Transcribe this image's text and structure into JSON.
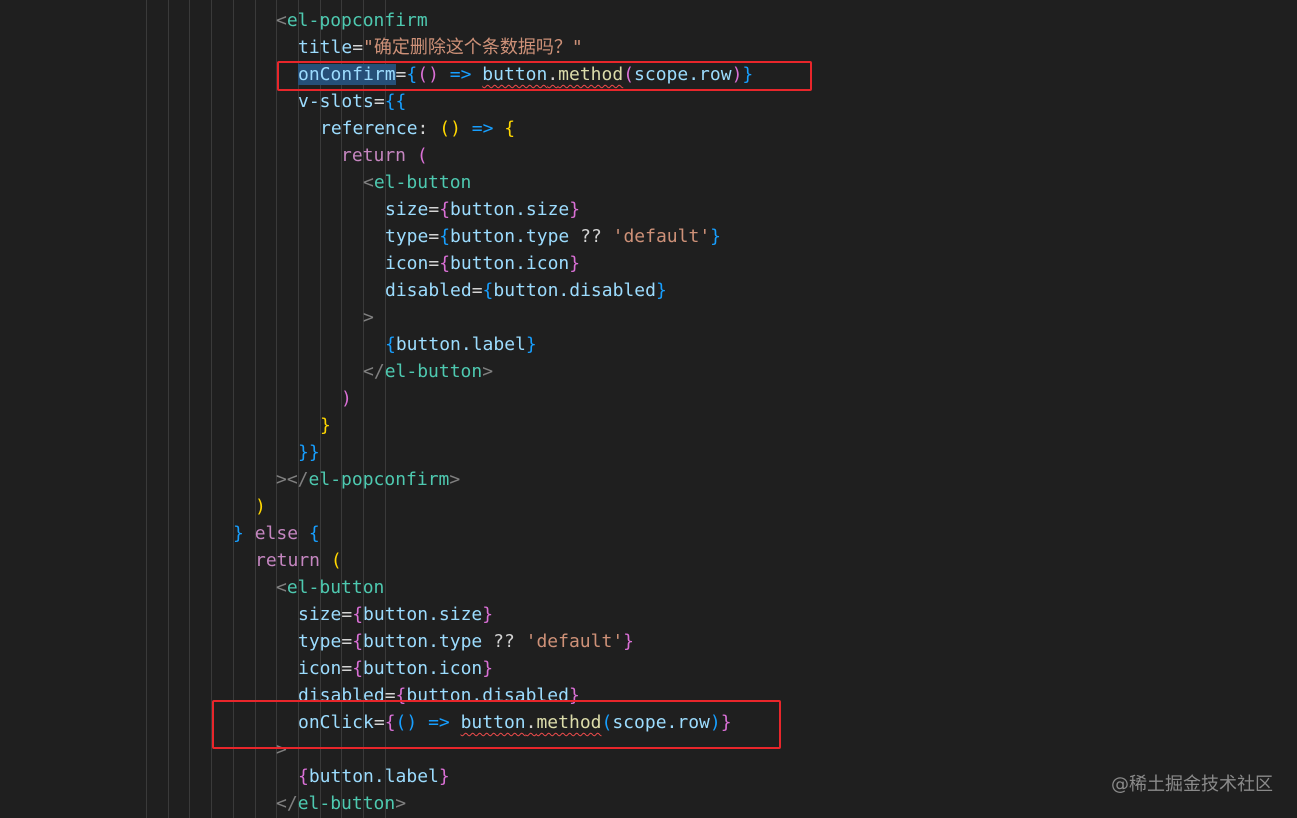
{
  "code_lines": [
    {
      "indent": 12,
      "tokens": [
        {
          "t": "<",
          "c": "punct"
        },
        {
          "t": "el-popconfirm",
          "c": "tag"
        }
      ]
    },
    {
      "indent": 14,
      "tokens": [
        {
          "t": "title",
          "c": "attr"
        },
        {
          "t": "=",
          "c": "plain"
        },
        {
          "t": "\"确定删除这个条数据吗？\"",
          "c": "string"
        }
      ]
    },
    {
      "indent": 14,
      "tokens": [
        {
          "t": "onConfirm",
          "c": "attr-hl"
        },
        {
          "t": "=",
          "c": "plain"
        },
        {
          "t": "{",
          "c": "brace3"
        },
        {
          "t": "()",
          "c": "brace2"
        },
        {
          "t": " => ",
          "c": "brace3"
        },
        {
          "t": "button",
          "c": "var",
          "sq": true
        },
        {
          "t": ".",
          "c": "plain",
          "sq": true
        },
        {
          "t": "method",
          "c": "func",
          "sq": true
        },
        {
          "t": "(",
          "c": "brace2"
        },
        {
          "t": "scope.row",
          "c": "var"
        },
        {
          "t": ")",
          "c": "brace2"
        },
        {
          "t": "}",
          "c": "brace3"
        }
      ]
    },
    {
      "indent": 14,
      "tokens": [
        {
          "t": "v-slots",
          "c": "attr"
        },
        {
          "t": "=",
          "c": "plain"
        },
        {
          "t": "{{",
          "c": "brace3"
        }
      ]
    },
    {
      "indent": 16,
      "tokens": [
        {
          "t": "reference",
          "c": "attr"
        },
        {
          "t": ": ",
          "c": "plain"
        },
        {
          "t": "()",
          "c": "brace1"
        },
        {
          "t": " => ",
          "c": "brace3"
        },
        {
          "t": "{",
          "c": "brace1"
        }
      ]
    },
    {
      "indent": 18,
      "tokens": [
        {
          "t": "return",
          "c": "keyword"
        },
        {
          "t": " ",
          "c": "plain"
        },
        {
          "t": "(",
          "c": "brace2"
        }
      ]
    },
    {
      "indent": 20,
      "tokens": [
        {
          "t": "<",
          "c": "punct"
        },
        {
          "t": "el-button",
          "c": "tag"
        }
      ]
    },
    {
      "indent": 22,
      "tokens": [
        {
          "t": "size",
          "c": "attr"
        },
        {
          "t": "=",
          "c": "plain"
        },
        {
          "t": "{",
          "c": "brace2"
        },
        {
          "t": "button.size",
          "c": "var"
        },
        {
          "t": "}",
          "c": "brace2"
        }
      ]
    },
    {
      "indent": 22,
      "tokens": [
        {
          "t": "type",
          "c": "attr"
        },
        {
          "t": "=",
          "c": "plain"
        },
        {
          "t": "{",
          "c": "brace3"
        },
        {
          "t": "button.type",
          "c": "var"
        },
        {
          "t": " ?? ",
          "c": "plain"
        },
        {
          "t": "'default'",
          "c": "string"
        },
        {
          "t": "}",
          "c": "brace3"
        }
      ]
    },
    {
      "indent": 22,
      "tokens": [
        {
          "t": "icon",
          "c": "attr"
        },
        {
          "t": "=",
          "c": "plain"
        },
        {
          "t": "{",
          "c": "brace2"
        },
        {
          "t": "button.icon",
          "c": "var"
        },
        {
          "t": "}",
          "c": "brace2"
        }
      ]
    },
    {
      "indent": 22,
      "tokens": [
        {
          "t": "disabled",
          "c": "attr"
        },
        {
          "t": "=",
          "c": "plain"
        },
        {
          "t": "{",
          "c": "brace3"
        },
        {
          "t": "button.disabled",
          "c": "var"
        },
        {
          "t": "}",
          "c": "brace3"
        }
      ]
    },
    {
      "indent": 20,
      "tokens": [
        {
          "t": ">",
          "c": "punct"
        }
      ]
    },
    {
      "indent": 22,
      "tokens": [
        {
          "t": "{",
          "c": "brace3"
        },
        {
          "t": "button.label",
          "c": "var"
        },
        {
          "t": "}",
          "c": "brace3"
        }
      ]
    },
    {
      "indent": 20,
      "tokens": [
        {
          "t": "</",
          "c": "punct"
        },
        {
          "t": "el-button",
          "c": "tag"
        },
        {
          "t": ">",
          "c": "punct"
        }
      ]
    },
    {
      "indent": 18,
      "tokens": [
        {
          "t": ")",
          "c": "brace2"
        }
      ]
    },
    {
      "indent": 16,
      "tokens": [
        {
          "t": "}",
          "c": "brace1"
        }
      ]
    },
    {
      "indent": 14,
      "tokens": [
        {
          "t": "}}",
          "c": "brace3"
        }
      ]
    },
    {
      "indent": 12,
      "tokens": [
        {
          "t": "></",
          "c": "punct"
        },
        {
          "t": "el-popconfirm",
          "c": "tag"
        },
        {
          "t": ">",
          "c": "punct"
        }
      ]
    },
    {
      "indent": 10,
      "tokens": [
        {
          "t": ")",
          "c": "brace1"
        }
      ]
    },
    {
      "indent": 8,
      "tokens": [
        {
          "t": "}",
          "c": "brace3"
        },
        {
          "t": " ",
          "c": "plain"
        },
        {
          "t": "else",
          "c": "keyword"
        },
        {
          "t": " ",
          "c": "plain"
        },
        {
          "t": "{",
          "c": "brace3"
        }
      ]
    },
    {
      "indent": 10,
      "tokens": [
        {
          "t": "return",
          "c": "keyword"
        },
        {
          "t": " ",
          "c": "plain"
        },
        {
          "t": "(",
          "c": "brace1"
        }
      ]
    },
    {
      "indent": 12,
      "tokens": [
        {
          "t": "<",
          "c": "punct"
        },
        {
          "t": "el-button",
          "c": "tag"
        }
      ]
    },
    {
      "indent": 14,
      "tokens": [
        {
          "t": "size",
          "c": "attr"
        },
        {
          "t": "=",
          "c": "plain"
        },
        {
          "t": "{",
          "c": "brace2"
        },
        {
          "t": "button.size",
          "c": "var"
        },
        {
          "t": "}",
          "c": "brace2"
        }
      ]
    },
    {
      "indent": 14,
      "tokens": [
        {
          "t": "type",
          "c": "attr"
        },
        {
          "t": "=",
          "c": "plain"
        },
        {
          "t": "{",
          "c": "brace2"
        },
        {
          "t": "button.type",
          "c": "var"
        },
        {
          "t": " ?? ",
          "c": "plain"
        },
        {
          "t": "'default'",
          "c": "string"
        },
        {
          "t": "}",
          "c": "brace2"
        }
      ]
    },
    {
      "indent": 14,
      "tokens": [
        {
          "t": "icon",
          "c": "attr"
        },
        {
          "t": "=",
          "c": "plain"
        },
        {
          "t": "{",
          "c": "brace2"
        },
        {
          "t": "button.icon",
          "c": "var"
        },
        {
          "t": "}",
          "c": "brace2"
        }
      ]
    },
    {
      "indent": 14,
      "tokens": [
        {
          "t": "disabled",
          "c": "attr"
        },
        {
          "t": "=",
          "c": "plain"
        },
        {
          "t": "{",
          "c": "brace2"
        },
        {
          "t": "button.disabled",
          "c": "var"
        },
        {
          "t": "}",
          "c": "brace2"
        }
      ]
    },
    {
      "indent": 14,
      "tokens": [
        {
          "t": "onClick",
          "c": "attr"
        },
        {
          "t": "=",
          "c": "plain"
        },
        {
          "t": "{",
          "c": "brace2"
        },
        {
          "t": "()",
          "c": "brace3"
        },
        {
          "t": " => ",
          "c": "brace3"
        },
        {
          "t": "button",
          "c": "var",
          "sq": true
        },
        {
          "t": ".",
          "c": "plain",
          "sq": true
        },
        {
          "t": "method",
          "c": "func",
          "sq": true
        },
        {
          "t": "(",
          "c": "brace3"
        },
        {
          "t": "scope.row",
          "c": "var"
        },
        {
          "t": ")",
          "c": "brace3"
        },
        {
          "t": "}",
          "c": "brace2"
        }
      ]
    },
    {
      "indent": 12,
      "tokens": [
        {
          "t": ">",
          "c": "punct"
        }
      ]
    },
    {
      "indent": 14,
      "tokens": [
        {
          "t": "{",
          "c": "brace2"
        },
        {
          "t": "button.label",
          "c": "var"
        },
        {
          "t": "}",
          "c": "brace2"
        }
      ]
    },
    {
      "indent": 12,
      "tokens": [
        {
          "t": "</",
          "c": "punct"
        },
        {
          "t": "el-button",
          "c": "tag"
        },
        {
          "t": ">",
          "c": "punct"
        }
      ]
    }
  ],
  "highlights": {
    "box1_label": "onConfirm handler highlight",
    "box2_label": "onClick handler highlight"
  },
  "watermark": "@稀土掘金技术社区",
  "colors": {
    "background": "#1f1f1f",
    "highlight_box": "#e8262b"
  }
}
